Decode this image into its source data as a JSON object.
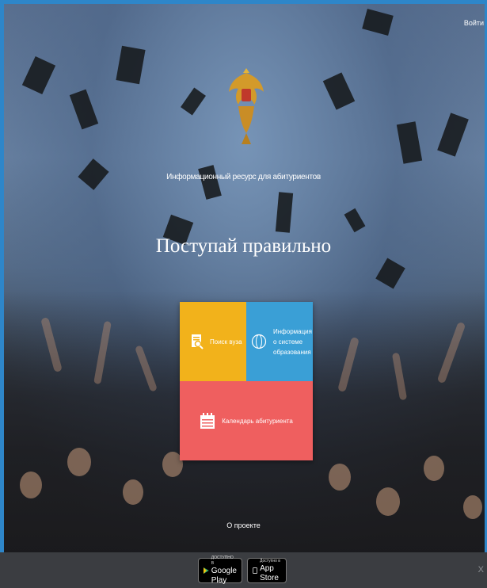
{
  "header": {
    "login_label": "Войти"
  },
  "hero": {
    "subtitle": "Информационный ресурс для абитуриентов",
    "title": "Поступай правильно"
  },
  "tiles": [
    {
      "label": "Поиск вуза",
      "icon": "document-search-icon",
      "color": "#f2b21b"
    },
    {
      "label_lines": [
        "Информация",
        "о системе",
        "образования"
      ],
      "icon": "globe-icon",
      "color": "#3a9fd6"
    },
    {
      "label": "Календарь абитуриента",
      "icon": "calendar-icon",
      "color": "#ef5f5f"
    }
  ],
  "footer_link": "О проекте",
  "app_badges": {
    "google": {
      "small": "ДОСТУПНО В",
      "big": "Google Play",
      "icon": "google-play-icon"
    },
    "apple": {
      "small": "Доступно в",
      "big": "App Store",
      "icon": "apple-icon"
    }
  },
  "close_label": "X",
  "colors": {
    "frame": "#2e86c9",
    "footer": "#3b3d41"
  }
}
